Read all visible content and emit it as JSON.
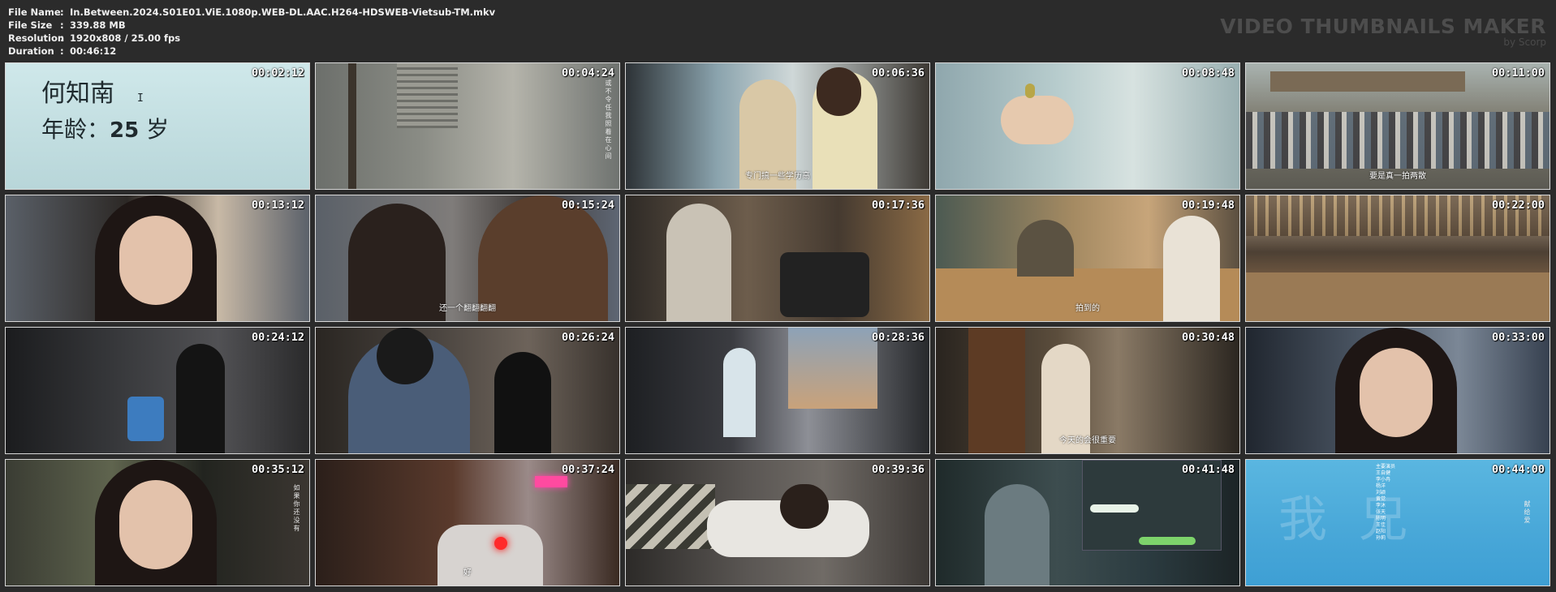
{
  "file_info": [
    {
      "key": "File Name",
      "sep": ":",
      "value": "In.Between.2024.S01E01.ViE.1080p.WEB-DL.AAC.H264-HDSWEB-Vietsub-TM.mkv"
    },
    {
      "key": "File Size",
      "sep": ":",
      "value": "339.88 MB"
    },
    {
      "key": "Resolution",
      "sep": ":",
      "value": "1920x808 / 25.00 fps"
    },
    {
      "key": "Duration",
      "sep": ":",
      "value": "00:46:12"
    }
  ],
  "brand": {
    "title": "VIDEO THUMBNAILS MAKER",
    "by": "by Scorp"
  },
  "thumbnails": [
    {
      "time": "00:02:12",
      "subtitle": "",
      "scene": "title-card-name-age"
    },
    {
      "time": "00:04:24",
      "subtitle": "",
      "scene": "street-stairs"
    },
    {
      "time": "00:06:36",
      "subtitle": "专门搞一些学历高",
      "scene": "office-two-women"
    },
    {
      "time": "00:08:48",
      "subtitle": "",
      "scene": "hand-holding-object"
    },
    {
      "time": "00:11:00",
      "subtitle": "要是真一拍两散",
      "scene": "busy-street-market"
    },
    {
      "time": "00:13:12",
      "subtitle": "",
      "scene": "woman-closeup-bangs"
    },
    {
      "time": "00:15:24",
      "subtitle": "还一个翻翻翻翻",
      "scene": "two-women-sitting"
    },
    {
      "time": "00:17:36",
      "subtitle": "",
      "scene": "gym"
    },
    {
      "time": "00:19:48",
      "subtitle": "拍到的",
      "scene": "dinner-table"
    },
    {
      "time": "00:22:00",
      "subtitle": "",
      "scene": "bar-counter"
    },
    {
      "time": "00:24:12",
      "subtitle": "",
      "scene": "dark-room-woman"
    },
    {
      "time": "00:26:24",
      "subtitle": "",
      "scene": "man-woman-kitchen-table"
    },
    {
      "time": "00:28:36",
      "subtitle": "",
      "scene": "woman-at-desk-window"
    },
    {
      "time": "00:30:48",
      "subtitle": "今天的会很重要",
      "scene": "woman-in-doorway"
    },
    {
      "time": "00:33:00",
      "subtitle": "",
      "scene": "crowd-audience"
    },
    {
      "time": "00:35:12",
      "subtitle": "",
      "scene": "woman-closeup-alley"
    },
    {
      "time": "00:37:24",
      "subtitle": "好",
      "scene": "night-street-car"
    },
    {
      "time": "00:39:36",
      "subtitle": "",
      "scene": "man-lying-bed"
    },
    {
      "time": "00:41:48",
      "subtitle": "",
      "scene": "man-at-computer"
    },
    {
      "time": "00:44:00",
      "subtitle": "",
      "scene": "credits-blue"
    }
  ],
  "title_card": {
    "name": "何知南",
    "age_label": "年龄：",
    "age_value": "25",
    "age_unit": "岁"
  },
  "vertical_texts": {
    "t2": "或不令任我照着在心间",
    "t16": "如果你还没有",
    "t20_big": "我 兄",
    "t20_side": "献给爱"
  },
  "credits_list": [
    "主要演员",
    "王自健",
    "李小冉",
    "杨洋",
    "刘颖",
    "黄觉",
    "李沐",
    "张天",
    "陈明",
    "王佳",
    "赵阳",
    "孙莉"
  ],
  "colors": {
    "background": "#2b2b2b",
    "brand": "#4d4d4d",
    "thumb_border": "#d8d8d8"
  }
}
